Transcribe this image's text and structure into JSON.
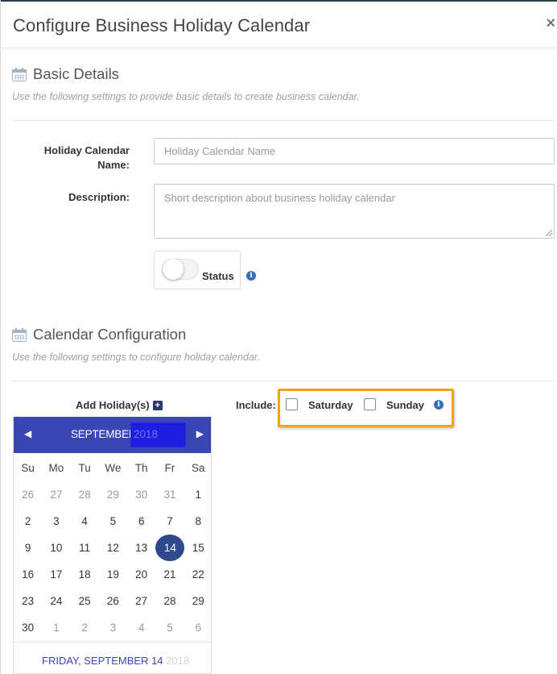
{
  "modal": {
    "title": "Configure Business Holiday Calendar",
    "close_label": "×"
  },
  "basic_details": {
    "title": "Basic Details",
    "description": "Use the following settings to provide basic details to create business calendar.",
    "name_label_line1": "Holiday Calendar",
    "name_label_line2": "Name:",
    "name_placeholder": "Holiday Calendar Name",
    "name_value": "",
    "description_label": "Description:",
    "description_placeholder": "Short description about business holiday calendar",
    "description_value": "",
    "status_label": "Status",
    "status_on": false
  },
  "calendar_config": {
    "title": "Calendar Configuration",
    "description": "Use the following settings to configure holiday calendar.",
    "add_holiday_label": "Add Holiday(s)",
    "include_label": "Include:",
    "saturday_label": "Saturday",
    "saturday_checked": false,
    "sunday_label": "Sunday",
    "sunday_checked": false
  },
  "calendar": {
    "prev_label": "◀",
    "next_label": "▶",
    "month": "SEPTEMBER",
    "year": "2018",
    "weekdays": [
      "Su",
      "Mo",
      "Tu",
      "We",
      "Th",
      "Fr",
      "Sa"
    ],
    "weeks": [
      [
        [
          "26",
          true
        ],
        [
          "27",
          true
        ],
        [
          "28",
          true
        ],
        [
          "29",
          true
        ],
        [
          "30",
          true
        ],
        [
          "31",
          true
        ],
        [
          "1",
          false
        ]
      ],
      [
        [
          "2",
          false
        ],
        [
          "3",
          false
        ],
        [
          "4",
          false
        ],
        [
          "5",
          false
        ],
        [
          "6",
          false
        ],
        [
          "7",
          false
        ],
        [
          "8",
          false
        ]
      ],
      [
        [
          "9",
          false
        ],
        [
          "10",
          false
        ],
        [
          "11",
          false
        ],
        [
          "12",
          false
        ],
        [
          "13",
          false
        ],
        [
          "14",
          false
        ],
        [
          "15",
          false
        ]
      ],
      [
        [
          "16",
          false
        ],
        [
          "17",
          false
        ],
        [
          "18",
          false
        ],
        [
          "19",
          false
        ],
        [
          "20",
          false
        ],
        [
          "21",
          false
        ],
        [
          "22",
          false
        ]
      ],
      [
        [
          "23",
          false
        ],
        [
          "24",
          false
        ],
        [
          "25",
          false
        ],
        [
          "26",
          false
        ],
        [
          "27",
          false
        ],
        [
          "28",
          false
        ],
        [
          "29",
          false
        ]
      ],
      [
        [
          "30",
          false
        ],
        [
          "1",
          true
        ],
        [
          "2",
          true
        ],
        [
          "3",
          true
        ],
        [
          "4",
          true
        ],
        [
          "5",
          true
        ],
        [
          "6",
          true
        ]
      ]
    ],
    "selected_day": "14",
    "footer_date": "FRIDAY, SEPTEMBER 14",
    "footer_year": "2018"
  },
  "colors": {
    "calendar_header": "#3b46b5",
    "selected_day": "#2e4a8a",
    "highlight_border": "#f0a21a",
    "info_icon": "#3a6fb8"
  }
}
